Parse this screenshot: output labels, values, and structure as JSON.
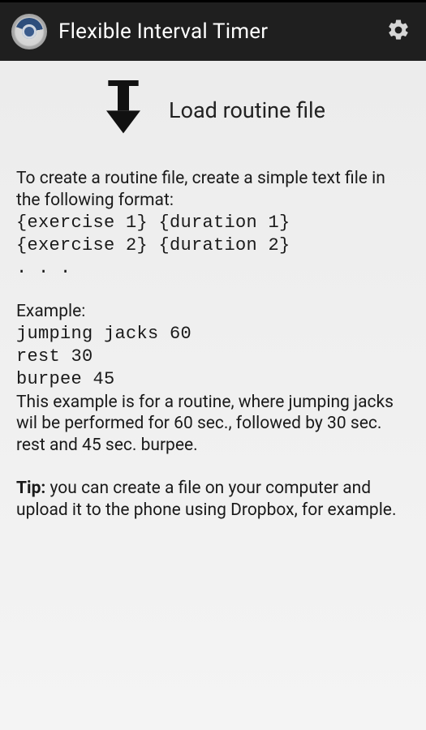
{
  "header": {
    "title": "Flexible Interval Timer"
  },
  "load_button": {
    "label": "Load routine file"
  },
  "instructions": {
    "intro": "To create a routine file, create a simple text file in the following format:",
    "format_line1": "{exercise 1} {duration 1}",
    "format_line2": "{exercise 2} {duration 2}",
    "format_line3": ". . .",
    "example_heading": "Example:",
    "example_line1": "jumping jacks 60",
    "example_line2": "rest 30",
    "example_line3": "burpee 45",
    "example_explain": "This example is for a routine, where jumping jacks wil be performed for 60 sec., followed by 30 sec. rest and 45 sec. burpee.",
    "tip_label": "Tip:",
    "tip_text": " you can create a file on your computer and upload it to the phone using Dropbox, for example."
  }
}
